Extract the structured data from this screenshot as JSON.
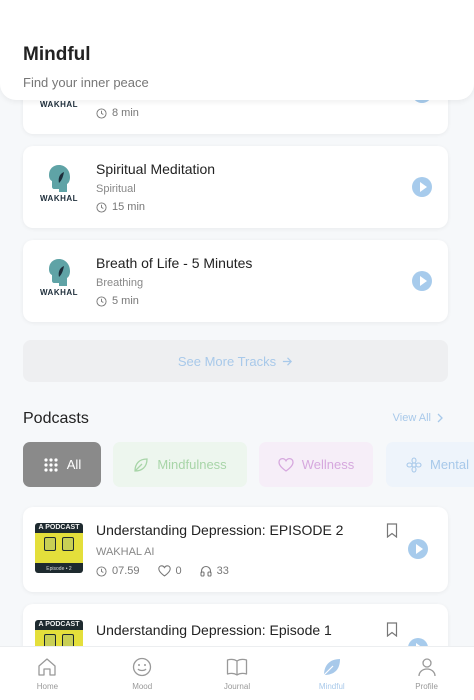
{
  "header": {
    "title": "Mindful",
    "subtitle": "Find your inner peace"
  },
  "brand": {
    "logo_text": "WAKHAL"
  },
  "tracks": [
    {
      "title": "",
      "category": "",
      "duration": "8 min"
    },
    {
      "title": "Spiritual Meditation",
      "category": "Spiritual",
      "duration": "15 min"
    },
    {
      "title": "Breath of Life - 5 Minutes",
      "category": "Breathing",
      "duration": "5 min"
    }
  ],
  "see_more": {
    "label": "See More Tracks"
  },
  "podcasts_section": {
    "title": "Podcasts",
    "view_all": "View All"
  },
  "chips": [
    {
      "label": "All",
      "icon": "grid-icon",
      "bg": "#8a8a8a",
      "fg": "#ffffff"
    },
    {
      "label": "Mindfulness",
      "icon": "leaf-icon",
      "bg": "#edf6ee",
      "fg": "#a8d5a8"
    },
    {
      "label": "Wellness",
      "icon": "heart-icon",
      "bg": "#f6eef8",
      "fg": "#d6a8de"
    },
    {
      "label": "Mental",
      "icon": "flower-icon",
      "bg": "#eef4fb",
      "fg": "#a8c9ea"
    }
  ],
  "podcasts": [
    {
      "title": "Understanding Depression: EPISODE 2",
      "author": "WAKHAL AI",
      "duration": "07.59",
      "likes": "0",
      "listens": "33",
      "thumb_text": "A PODCAST",
      "thumb_episode": "Episode • 2"
    },
    {
      "title": "Understanding Depression: Episode 1",
      "author": "",
      "duration": "",
      "likes": "",
      "listens": "",
      "thumb_text": "A PODCAST",
      "thumb_episode": ""
    }
  ],
  "nav": [
    {
      "label": "Home",
      "icon": "home-icon"
    },
    {
      "label": "Mood",
      "icon": "smile-icon"
    },
    {
      "label": "Journal",
      "icon": "book-icon"
    },
    {
      "label": "Mindful",
      "icon": "leaf-icon",
      "active": true
    },
    {
      "label": "Profile",
      "icon": "person-icon"
    }
  ],
  "colors": {
    "accent": "#a8c9ea",
    "play": "#a7cbec",
    "logo_head": "#5fa3a6"
  }
}
